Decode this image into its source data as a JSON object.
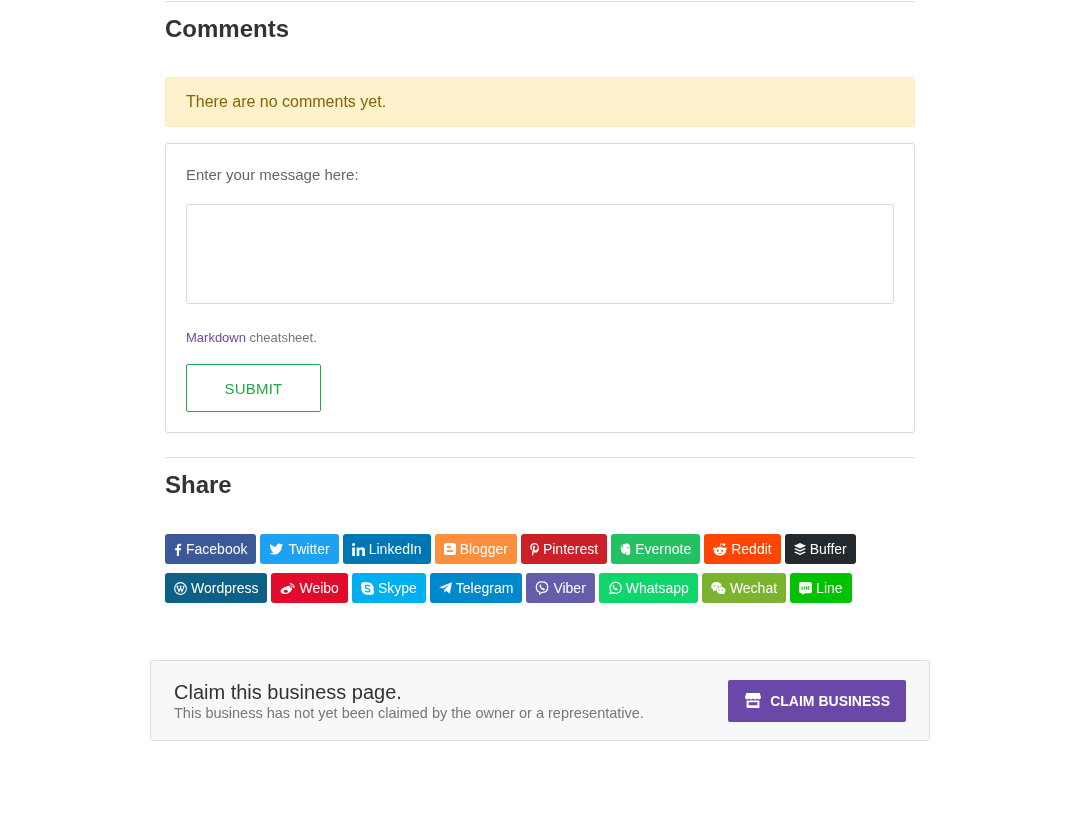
{
  "comments": {
    "heading": "Comments",
    "notice": "There are no comments yet.",
    "form": {
      "label": "Enter your message here:",
      "help": {
        "link": "Markdown",
        "text": "cheatsheet."
      },
      "submit_button": "SUBMIT"
    }
  },
  "share": {
    "heading": "Share",
    "buttons": [
      {
        "label": "Facebook",
        "kind": "facebook",
        "color": "#3b5998"
      },
      {
        "label": "Twitter",
        "kind": "twitter",
        "color": "#1da1f2"
      },
      {
        "label": "LinkedIn",
        "kind": "linkedin",
        "color": "#0077b5"
      },
      {
        "label": "Blogger",
        "kind": "blogger",
        "color": "#fb8f3d"
      },
      {
        "label": "Pinterest",
        "kind": "pinterest",
        "color": "#cb2027"
      },
      {
        "label": "Evernote",
        "kind": "evernote",
        "color": "#24c064"
      },
      {
        "label": "Reddit",
        "kind": "reddit",
        "color": "#ff4500"
      },
      {
        "label": "Buffer",
        "kind": "buffer",
        "color": "#24292e"
      },
      {
        "label": "Wordpress",
        "kind": "wordpress",
        "color": "#0f6086"
      },
      {
        "label": "Weibo",
        "kind": "weibo",
        "color": "#e20b2c"
      },
      {
        "label": "Skype",
        "kind": "skype",
        "color": "#00aff0"
      },
      {
        "label": "Telegram",
        "kind": "telegram",
        "color": "#0088cc"
      },
      {
        "label": "Viber",
        "kind": "viber",
        "color": "#665cac"
      },
      {
        "label": "Whatsapp",
        "kind": "whatsapp",
        "color": "#10d56a"
      },
      {
        "label": "Wechat",
        "kind": "wechat",
        "color": "#7bb32e"
      },
      {
        "label": "Line",
        "kind": "line",
        "color": "#00c300"
      }
    ]
  },
  "claim": {
    "title": "Claim this business page.",
    "subtitle": "This business has not yet been claimed by the owner or a representative.",
    "button": "CLAIM BUSINESS"
  }
}
